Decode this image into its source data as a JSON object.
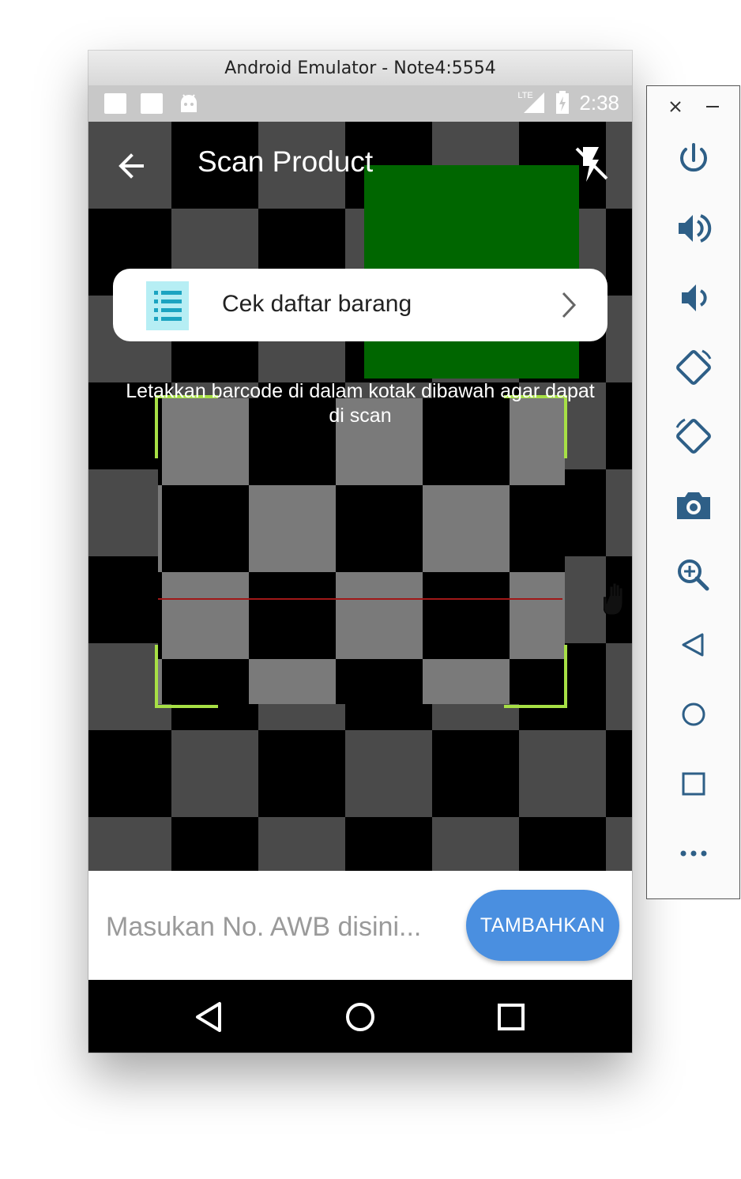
{
  "window": {
    "title": "Android Emulator - Note4:5554"
  },
  "status_bar": {
    "network": "LTE",
    "time": "2:38"
  },
  "app_bar": {
    "title": "Scan Product"
  },
  "list_card": {
    "label": "Cek daftar barang"
  },
  "scanner": {
    "instructions": "Letakkan barcode di dalam kotak dibawah agar dapat di scan"
  },
  "bottom": {
    "awb_placeholder": "Masukan No. AWB disini...",
    "add_button": "TAMBAHKAN"
  },
  "colors": {
    "scan_corner": "#a7e045",
    "laser": "#a01818",
    "primary_button": "#4a8fe0",
    "list_icon_bg": "#b6eef4",
    "side_icon": "#2e5f87"
  },
  "side_panel": {
    "controls": [
      "close-icon",
      "minimize-icon",
      "power-icon",
      "volume-up-icon",
      "volume-down-icon",
      "rotate-left-icon",
      "rotate-right-icon",
      "camera-icon",
      "zoom-icon",
      "back-icon",
      "home-icon",
      "overview-icon",
      "more-icon"
    ]
  }
}
